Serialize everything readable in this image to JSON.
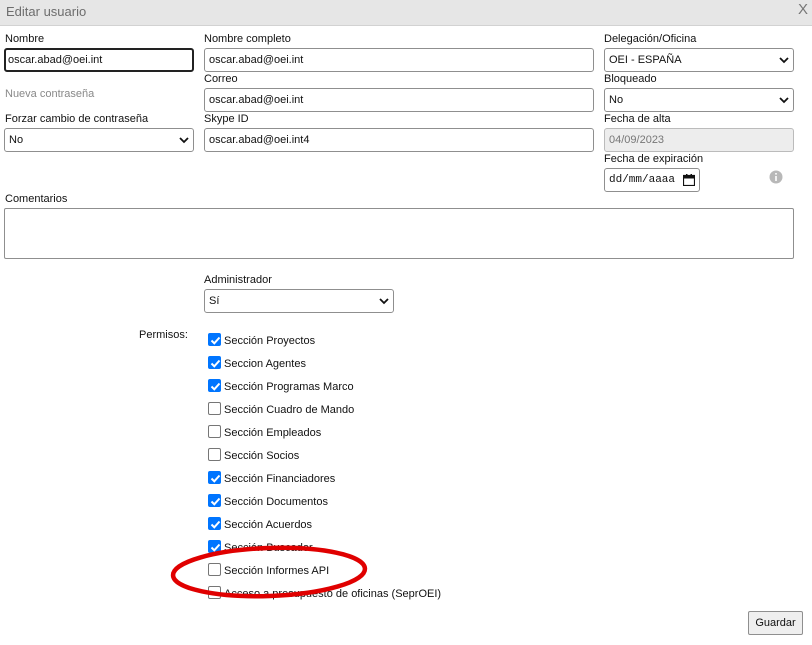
{
  "dialog": {
    "title": "Editar usuario",
    "close_label": "X"
  },
  "form": {
    "nombre": {
      "label": "Nombre",
      "value": "oscar.abad@oei.int"
    },
    "nueva_contrasena": {
      "label": "Nueva contraseña"
    },
    "forzar_cambio": {
      "label": "Forzar cambio de contraseña",
      "value": "No"
    },
    "nombre_completo": {
      "label": "Nombre completo",
      "value": "oscar.abad@oei.int"
    },
    "correo": {
      "label": "Correo",
      "value": "oscar.abad@oei.int"
    },
    "skype": {
      "label": "Skype ID",
      "value": "oscar.abad@oei.int4"
    },
    "delegacion": {
      "label": "Delegación/Oficina",
      "value": "OEI - ESPAÑA"
    },
    "bloqueado": {
      "label": "Bloqueado",
      "value": "No"
    },
    "fecha_alta": {
      "label": "Fecha de alta",
      "value": "04/09/2023"
    },
    "fecha_expiracion": {
      "label": "Fecha de expiración",
      "value": "dd/mm/aaaa"
    },
    "comentarios": {
      "label": "Comentarios",
      "value": ""
    },
    "administrador": {
      "label": "Administrador",
      "value": "Sí"
    }
  },
  "permisos": {
    "label": "Permisos:",
    "items": [
      {
        "label": "Sección Proyectos",
        "checked": true
      },
      {
        "label": "Seccion Agentes",
        "checked": true
      },
      {
        "label": "Sección Programas Marco",
        "checked": true
      },
      {
        "label": "Sección Cuadro de Mando",
        "checked": false
      },
      {
        "label": "Sección Empleados",
        "checked": false
      },
      {
        "label": "Sección Socios",
        "checked": false
      },
      {
        "label": "Sección Financiadores",
        "checked": true
      },
      {
        "label": "Sección Documentos",
        "checked": true
      },
      {
        "label": "Sección Acuerdos",
        "checked": true
      },
      {
        "label": "Sección Buscador",
        "checked": true
      },
      {
        "label": "Sección Informes API",
        "checked": false
      },
      {
        "label": "Acceso a presupuesto de oficinas (SeprOEI)",
        "checked": false
      }
    ]
  },
  "save_label": "Guardar",
  "colors": {
    "accent": "#0075ff",
    "annotation": "#e00000",
    "titlebar": "#e6e6e6"
  }
}
